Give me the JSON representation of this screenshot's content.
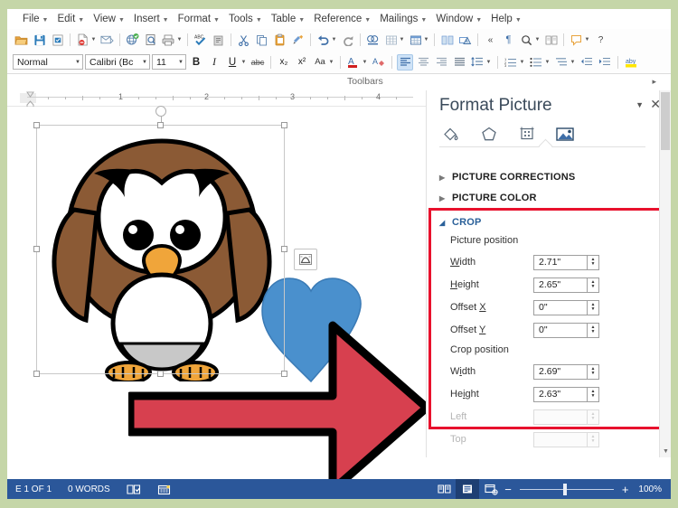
{
  "app": {
    "menu": [
      {
        "label": "File"
      },
      {
        "label": "Edit"
      },
      {
        "label": "View"
      },
      {
        "label": "Insert"
      },
      {
        "label": "Format"
      },
      {
        "label": "Tools"
      },
      {
        "label": "Table"
      },
      {
        "label": "Reference"
      },
      {
        "label": "Mailings"
      },
      {
        "label": "Window"
      },
      {
        "label": "Help"
      }
    ],
    "toolbars_label": "Toolbars"
  },
  "formatting": {
    "style": "Normal",
    "font": "Calibri (Bc",
    "size": "11",
    "bold": "B",
    "italic": "I",
    "underline": "U",
    "strikethrough": "abc",
    "subscript": "x₂",
    "superscript": "x²",
    "change_case": "Aa"
  },
  "ruler": {
    "numbers": [
      "1",
      "2",
      "3",
      "4"
    ]
  },
  "panel": {
    "title": "Format Picture",
    "tabs": [
      {
        "name": "fill-line-tab",
        "label": "Fill & Line"
      },
      {
        "name": "effects-tab",
        "label": "Effects"
      },
      {
        "name": "layout-properties-tab",
        "label": "Layout & Properties"
      },
      {
        "name": "picture-tab",
        "label": "Picture",
        "selected": true
      }
    ],
    "sections": [
      {
        "label": "PICTURE CORRECTIONS",
        "expanded": false
      },
      {
        "label": "PICTURE COLOR",
        "expanded": false
      },
      {
        "label": "CROP",
        "expanded": true
      }
    ],
    "crop": {
      "picture_position_label": "Picture position",
      "crop_position_label": "Crop position",
      "picture_position": [
        {
          "label": "Width",
          "value": "2.71\"",
          "disabled": false
        },
        {
          "label": "Height",
          "value": "2.65\"",
          "disabled": false
        },
        {
          "label": "Offset X",
          "value": "0\"",
          "disabled": false
        },
        {
          "label": "Offset Y",
          "value": "0\"",
          "disabled": false
        }
      ],
      "crop_position": [
        {
          "label": "Width",
          "value": "2.69\"",
          "disabled": false
        },
        {
          "label": "Height",
          "value": "2.63\"",
          "disabled": false
        },
        {
          "label": "Left",
          "value": "",
          "disabled": true
        },
        {
          "label": "Top",
          "value": "",
          "disabled": true
        }
      ]
    },
    "highlight_color": "#e8112d"
  },
  "status": {
    "page": "E 1 OF 1",
    "words": "0 WORDS",
    "zoom": "100%",
    "zoom_minus": "−",
    "zoom_plus": "+"
  },
  "colors": {
    "accent": "#2b579a",
    "highlight": "#e8112d",
    "arrow": "#d7404f",
    "heart": "#4a90cd",
    "owl_body": "#8b5a35",
    "desktop": "#c5d6a8"
  }
}
